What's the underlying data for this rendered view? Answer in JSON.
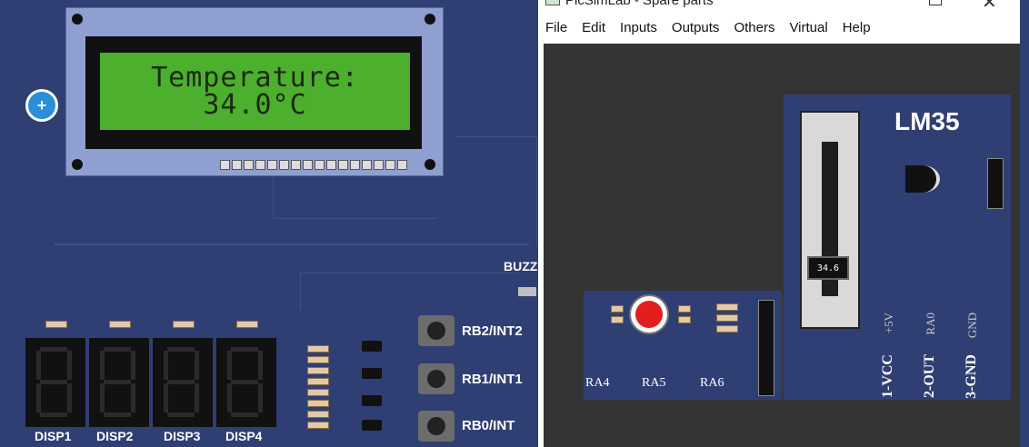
{
  "window": {
    "title": "PicSimLab - Spare parts",
    "menu": [
      "File",
      "Edit",
      "Inputs",
      "Outputs",
      "Others",
      "Virtual",
      "Help"
    ]
  },
  "main_board": {
    "lcd": {
      "line1": "Temperature:",
      "line2": "34.0°C"
    },
    "displays": [
      "DISP1",
      "DISP2",
      "DISP3",
      "DISP4"
    ],
    "buttons": [
      "RB2/INT2",
      "RB1/INT1",
      "RB0/INT"
    ],
    "buzzer_label": "BUZZ"
  },
  "lm35": {
    "title": "LM35",
    "slider_value": "34.6",
    "slider_level_fraction": 0.3,
    "pins": [
      "1-VCC",
      "2-OUT",
      "3-GND"
    ],
    "pin_signals": [
      "+5V",
      "RA0",
      "GND"
    ]
  },
  "led_board": {
    "labels": [
      "RA4",
      "RA5",
      "RA6"
    ],
    "led_color": "#e31e1e"
  },
  "colors": {
    "pcb": "#2f3f73",
    "lcd": "#4caf2e",
    "canvas": "#343434"
  }
}
